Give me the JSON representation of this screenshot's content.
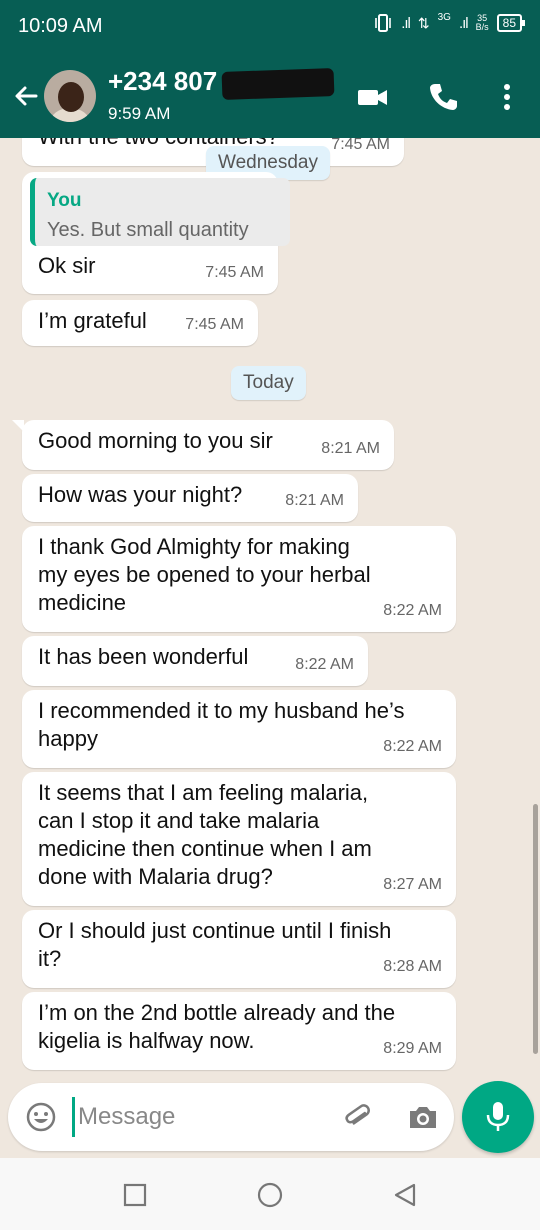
{
  "status_bar": {
    "time": "10:09 AM",
    "vibrate_icon": "vibrate-icon",
    "signal_1": ".ıl",
    "data_arrows": "⇅",
    "network_type": "3G",
    "signal_2": ".ıl",
    "speed_value": "35",
    "speed_unit": "B/s",
    "battery": "85"
  },
  "header": {
    "contact_name": "+234 807",
    "last_seen": "9:59 AM",
    "icons": [
      "back-arrow-icon",
      "video-call-icon",
      "phone-icon",
      "more-vert-icon"
    ]
  },
  "chat": {
    "date_chips": {
      "wednesday": "Wednesday",
      "today": "Today"
    },
    "clipped_message": {
      "text": "With the two containers?",
      "time": "7:45 AM"
    },
    "reply_message": {
      "quote_author": "You",
      "quote_text": "Yes. But small quantity",
      "text": "Ok sir",
      "time": "7:45 AM"
    },
    "messages": [
      {
        "text": "I’m grateful",
        "time": "7:45 AM"
      },
      {
        "text": "Good morning to you sir",
        "time": "8:21 AM"
      },
      {
        "text": "How was your night?",
        "time": "8:21 AM"
      },
      {
        "text": "I thank God Almighty for making\nmy eyes be opened to your herbal\nmedicine",
        "time": "8:22 AM"
      },
      {
        "text": "It has been wonderful",
        "time": "8:22 AM"
      },
      {
        "text": "I recommended it to my husband he’s\nhappy",
        "time": "8:22 AM"
      },
      {
        "text": "It seems that I am feeling malaria,\ncan I stop it and take malaria\nmedicine then continue when I am\ndone with Malaria drug?",
        "time": "8:27 AM"
      },
      {
        "text": "Or I should just continue until I finish\nit?",
        "time": "8:28 AM"
      },
      {
        "text": "I’m on the 2nd bottle already and the\nkigelia is halfway now.",
        "time": "8:29 AM"
      }
    ]
  },
  "input": {
    "placeholder": "Message",
    "icons": [
      "emoji-icon",
      "attach-icon",
      "camera-icon",
      "mic-icon"
    ]
  },
  "nav_bar": {
    "icons": [
      "recents-icon",
      "home-icon",
      "back-icon"
    ]
  },
  "colors": {
    "header": "#075e54",
    "accent": "#00a884",
    "chat_background": "#efe7de",
    "bubble": "#ffffff",
    "date_chip": "#e1f2fb"
  }
}
